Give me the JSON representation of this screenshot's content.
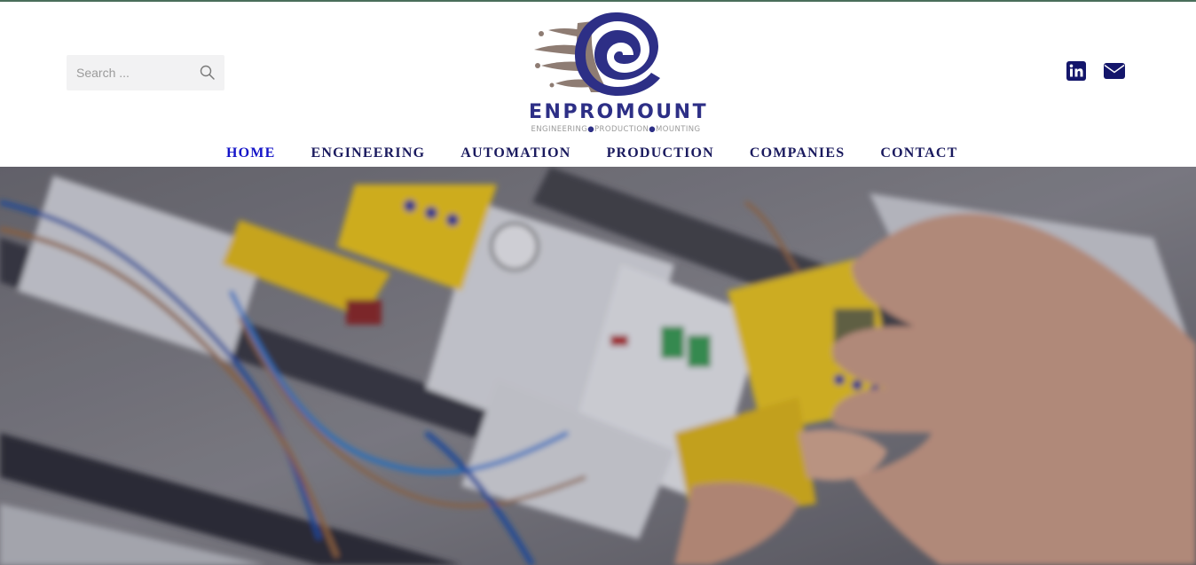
{
  "search": {
    "placeholder": "Search ..."
  },
  "logo": {
    "name": "ENPROMOUNT",
    "tagline_parts": [
      "ENGINEERING",
      "PRODUCTION",
      "MOUNTING"
    ]
  },
  "social": [
    {
      "name": "linkedin-icon",
      "label": "LinkedIn"
    },
    {
      "name": "envelope-icon",
      "label": "Email"
    }
  ],
  "nav": {
    "items": [
      {
        "label": "HOME",
        "active": true
      },
      {
        "label": "ENGINEERING",
        "active": false
      },
      {
        "label": "AUTOMATION",
        "active": false
      },
      {
        "label": "PRODUCTION",
        "active": false
      },
      {
        "label": "COMPANIES",
        "active": false
      },
      {
        "label": "CONTACT",
        "active": false
      }
    ]
  },
  "colors": {
    "brand": "#2d2f86",
    "nav_text": "#1a1a5e",
    "nav_active": "#1414c8",
    "search_bg": "#f2f2f3"
  }
}
